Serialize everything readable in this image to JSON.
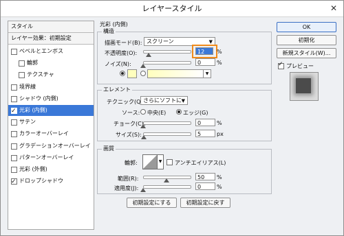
{
  "window": {
    "title": "レイヤースタイル",
    "close_glyph": "✕"
  },
  "left_panel": {
    "header": "スタイル",
    "subheader": "レイヤー効果：初期設定",
    "items": [
      {
        "label": "ベベルとエンボス",
        "checked": false,
        "indent": false,
        "selected": false
      },
      {
        "label": "輪郭",
        "checked": false,
        "indent": true,
        "selected": false
      },
      {
        "label": "テクスチャ",
        "checked": false,
        "indent": true,
        "selected": false
      },
      {
        "label": "境界線",
        "checked": false,
        "indent": false,
        "selected": false
      },
      {
        "label": "シャドウ (内側)",
        "checked": false,
        "indent": false,
        "selected": false
      },
      {
        "label": "光彩 (内側)",
        "checked": true,
        "indent": false,
        "selected": true
      },
      {
        "label": "サテン",
        "checked": false,
        "indent": false,
        "selected": false
      },
      {
        "label": "カラーオーバーレイ",
        "checked": false,
        "indent": false,
        "selected": false
      },
      {
        "label": "グラデーションオーバーレイ",
        "checked": false,
        "indent": false,
        "selected": false
      },
      {
        "label": "パターンオーバーレイ",
        "checked": false,
        "indent": false,
        "selected": false
      },
      {
        "label": "光彩 (外側)",
        "checked": false,
        "indent": false,
        "selected": false
      },
      {
        "label": "ドロップシャドウ",
        "checked": true,
        "indent": false,
        "selected": false
      }
    ]
  },
  "main": {
    "section_title": "光彩 (内側)",
    "structure": {
      "title": "構造",
      "blend_mode_label": "描画モード(B):",
      "blend_mode_value": "スクリーン",
      "opacity_label": "不透明度(O):",
      "opacity_value": "12",
      "opacity_level": 12,
      "noise_label": "ノイズ(N):",
      "noise_value": "0",
      "noise_level": 0,
      "unit_percent": "%",
      "glow_color": "#ffffbe"
    },
    "elements": {
      "title": "エレメント",
      "technique_label": "テクニック(Q):",
      "technique_value": "さらにソフトに",
      "source_label": "ソース:",
      "source_center": "中央(E)",
      "source_edge": "エッジ(G)",
      "choke_label": "チョーク(C):",
      "choke_value": "0",
      "choke_level": 0,
      "size_label": "サイズ(S):",
      "size_value": "5",
      "size_level": 2,
      "unit_percent": "%",
      "unit_px": "px"
    },
    "quality": {
      "title": "画質",
      "contour_label": "輪郭:",
      "antialias_label": "アンチエイリアス(L)",
      "range_label": "範囲(R):",
      "range_value": "50",
      "range_level": 50,
      "jitter_label": "適用度(J):",
      "jitter_value": "0",
      "jitter_level": 0,
      "unit_percent": "%"
    },
    "reset_button": "初期設定にする",
    "restore_button": "初期設定に戻す"
  },
  "right_panel": {
    "ok": "OK",
    "reset": "初期化",
    "new_style": "新規スタイル(W)...",
    "preview_label": "プレビュー"
  }
}
